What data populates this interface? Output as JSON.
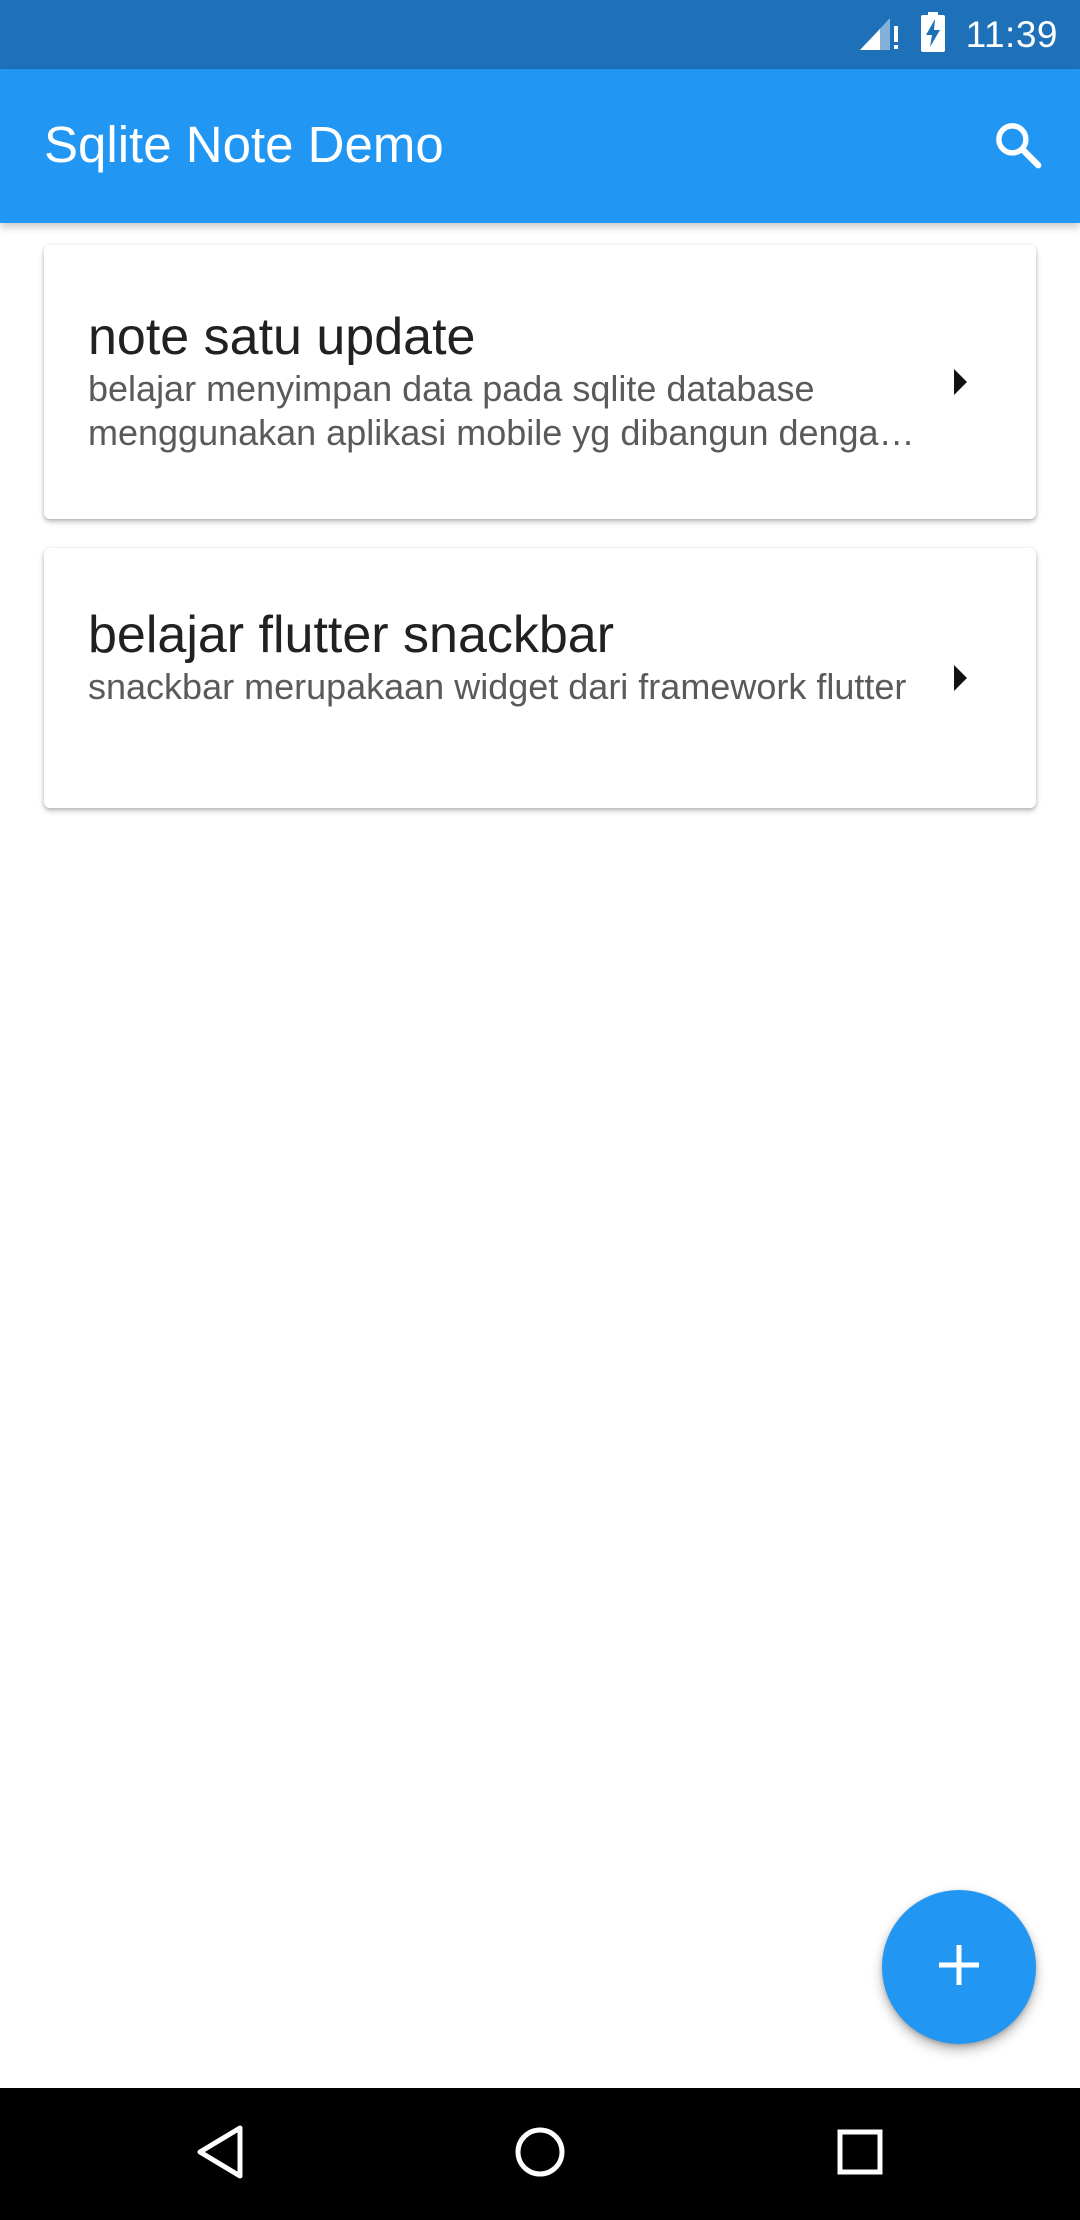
{
  "status_bar": {
    "time": "11:39",
    "icons": [
      "signal-icon",
      "battery-charging-icon"
    ]
  },
  "app_bar": {
    "title": "Sqlite Note Demo",
    "search_icon": "search-icon"
  },
  "notes": [
    {
      "title": "note satu update",
      "description": "belajar menyimpan data pada sqlite database menggunakan aplikasi mobile yg dibangun dengan flutter"
    },
    {
      "title": "belajar flutter snackbar",
      "description": "snackbar merupakaan widget dari framework flutter"
    }
  ],
  "fab": {
    "icon": "add-icon"
  },
  "nav_bar": {
    "icons": [
      "back-icon",
      "home-icon",
      "recents-icon"
    ]
  },
  "colors": {
    "status_bar": "#1e70b8",
    "app_bar": "#2196f3",
    "fab": "#2196f3",
    "nav_bar": "#000000",
    "title_text": "#212121",
    "desc_text": "#5a5a5a"
  }
}
